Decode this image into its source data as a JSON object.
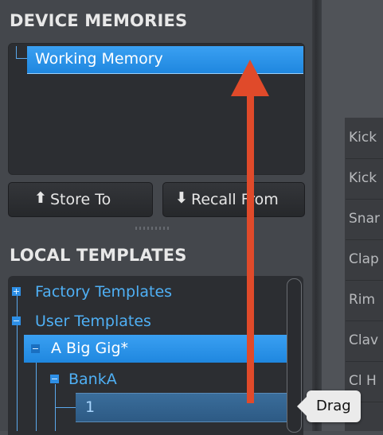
{
  "device_memories": {
    "title": "DEVICE MEMORIES",
    "items": [
      {
        "label": "Working Memory",
        "selected": true
      }
    ]
  },
  "buttons": {
    "store": {
      "label": "Store To",
      "icon": "arrow-up-icon"
    },
    "recall": {
      "label": "Recall From",
      "icon": "arrow-down-icon"
    }
  },
  "local_templates": {
    "title": "LOCAL TEMPLATES",
    "tree": [
      {
        "label": "Factory Templates",
        "icon": "expand-plus-icon"
      },
      {
        "label": "User Templates",
        "icon": "collapse-minus-icon"
      },
      {
        "label": "A Big Gig*",
        "icon": "collapse-minus-icon",
        "selected": true
      },
      {
        "label": "BankA",
        "icon": "collapse-minus-icon"
      },
      {
        "label": "1",
        "dragging": true
      }
    ]
  },
  "right_list": {
    "items": [
      "Kick",
      "Kick",
      "Snar",
      "Clap",
      "Rim",
      "Clav",
      "Cl H"
    ]
  },
  "tooltip": {
    "label": "Drag"
  },
  "colors": {
    "selection": "#2a93e8",
    "tree_text": "#4fb0f5",
    "annotation_arrow": "#e04a2a"
  }
}
